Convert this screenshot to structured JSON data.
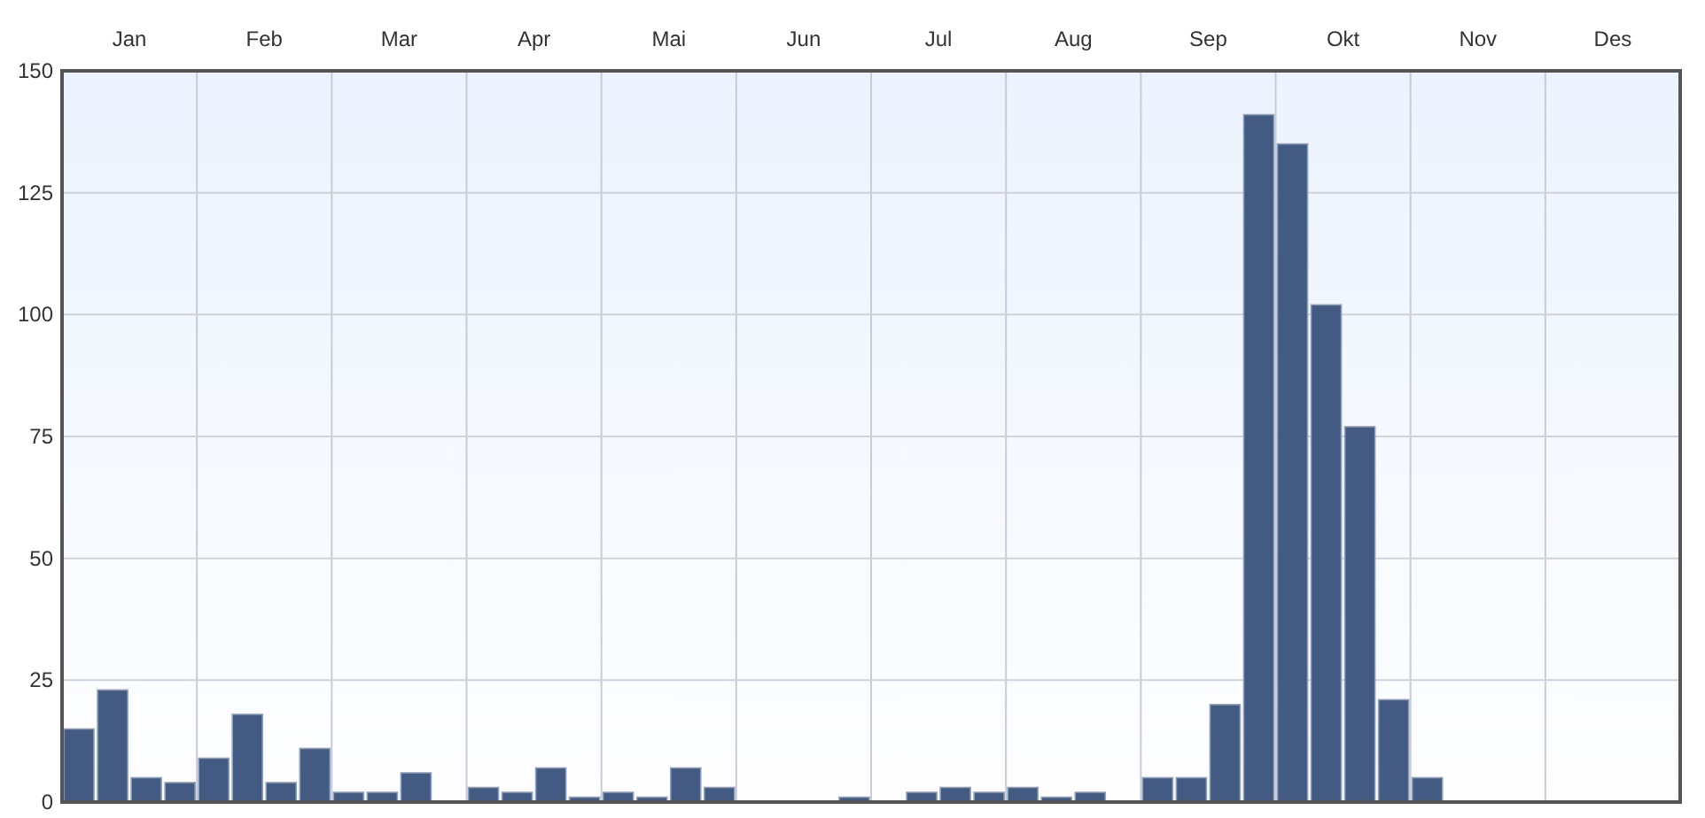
{
  "chart_data": {
    "type": "bar",
    "categories": [
      null,
      null,
      "Jan",
      null,
      null,
      null,
      "Feb",
      null,
      null,
      null,
      "Mar",
      null,
      null,
      null,
      "Apr",
      null,
      null,
      null,
      "Mai",
      null,
      null,
      null,
      "Jun",
      null,
      null,
      null,
      "Jul",
      null,
      null,
      null,
      "Aug",
      null,
      null,
      null,
      "Sep",
      null,
      null,
      null,
      "Okt",
      null,
      null,
      null,
      "Nov",
      null,
      null,
      null,
      "Des",
      null
    ],
    "series": [
      {
        "color": "#435a82",
        "values": [
          15,
          23,
          5,
          4,
          9,
          18,
          4,
          11,
          2,
          2,
          6,
          0,
          3,
          2,
          7,
          1,
          2,
          1,
          7,
          3,
          0,
          0,
          0,
          1,
          0,
          2,
          3,
          2,
          3,
          1,
          2,
          0,
          5,
          5,
          20,
          141,
          135,
          102,
          77,
          21,
          5,
          0,
          0,
          0,
          0,
          0,
          0,
          0
        ]
      }
    ],
    "ylim": [
      0,
      150
    ],
    "yticks": [
      0,
      25,
      50,
      75,
      100,
      125,
      150
    ],
    "grid": true
  }
}
